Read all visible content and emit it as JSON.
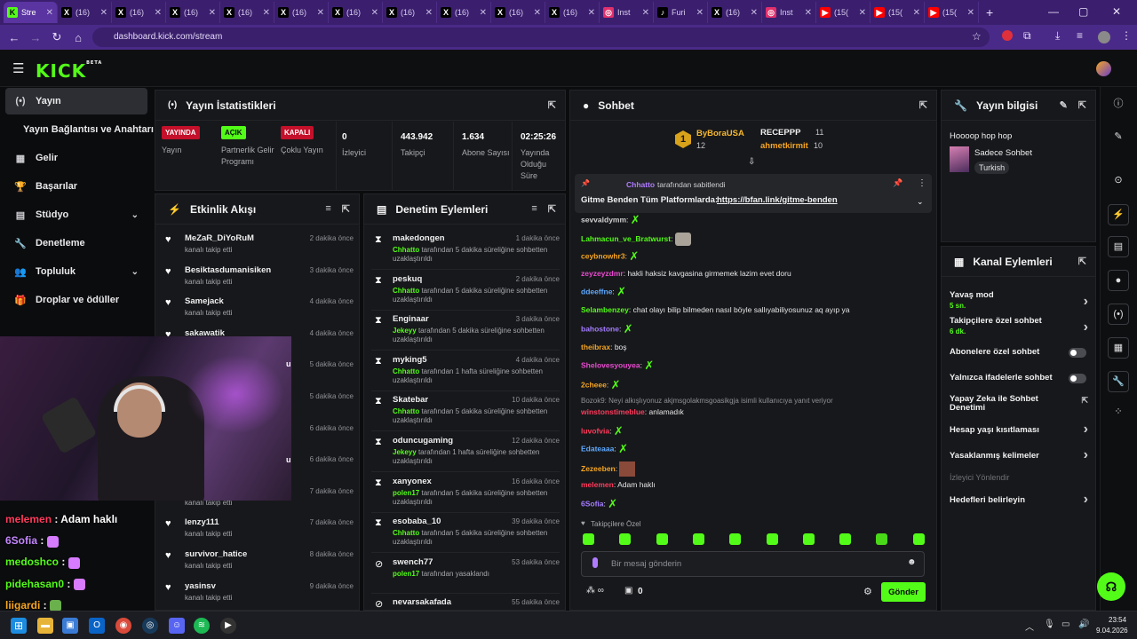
{
  "browser": {
    "tabs": [
      {
        "label": "Stre",
        "icon": "kick-icon",
        "active": true
      },
      {
        "label": "(16)",
        "icon": "x-icon"
      },
      {
        "label": "(16)",
        "icon": "x-icon"
      },
      {
        "label": "(16)",
        "icon": "x-icon"
      },
      {
        "label": "(16)",
        "icon": "x-icon"
      },
      {
        "label": "(16)",
        "icon": "x-icon"
      },
      {
        "label": "(16)",
        "icon": "x-icon"
      },
      {
        "label": "(16)",
        "icon": "x-icon"
      },
      {
        "label": "(16)",
        "icon": "x-icon"
      },
      {
        "label": "(16)",
        "icon": "x-icon"
      },
      {
        "label": "(16)",
        "icon": "x-icon"
      },
      {
        "label": "Inst",
        "icon": "instagram-icon"
      },
      {
        "label": "Furi",
        "icon": "tiktok-icon"
      },
      {
        "label": "(16)",
        "icon": "x-icon"
      },
      {
        "label": "Inst",
        "icon": "instagram-icon"
      },
      {
        "label": "(15(",
        "icon": "youtube-icon"
      },
      {
        "label": "(15(",
        "icon": "youtube-icon"
      },
      {
        "label": "(15(",
        "icon": "youtube-icon"
      }
    ],
    "url": "dashboard.kick.com/stream"
  },
  "brand": {
    "logo": "KICK",
    "beta": "BETA",
    "accent": "#53fc18"
  },
  "sidebar": {
    "items": [
      {
        "label": "Yayın",
        "icon": "broadcast-icon",
        "active": true
      },
      {
        "label": "Yayın Bağlantısı ve Anahtarı",
        "icon": ""
      },
      {
        "label": "Gelir",
        "icon": "bank-icon"
      },
      {
        "label": "Başarılar",
        "icon": "trophy-icon"
      },
      {
        "label": "Stüdyo",
        "icon": "studio-icon",
        "chevron": true
      },
      {
        "label": "Denetleme",
        "icon": "wrench-icon"
      },
      {
        "label": "Topluluk",
        "icon": "community-icon",
        "chevron": true
      },
      {
        "label": "Droplar ve ödüller",
        "icon": "gift-icon"
      }
    ]
  },
  "stats": {
    "title": "Yayın İstatistikleri",
    "live_badge": "YAYINDA",
    "live_label": "Yayın",
    "partner_badge": "AÇIK",
    "partner_label": "Partnerlik Gelir Programı",
    "multi_badge": "KAPALI",
    "multi_label": "Çoklu Yayın",
    "viewers_value": "0",
    "viewers_label": "İzleyici",
    "followers_value": "443.942",
    "followers_label": "Takipçi",
    "subs_value": "1.634",
    "subs_label": "Abone Sayısı",
    "uptime_value": "02:25:26",
    "uptime_label": "Yayında Olduğu Süre"
  },
  "events": {
    "title": "Etkinlik Akışı",
    "rows": [
      {
        "name": "MeZaR_DiYoRuM",
        "sub": "kanalı takip etti",
        "time": "2 dakika önce"
      },
      {
        "name": "Besiktasdumanisiken",
        "sub": "kanalı takip etti",
        "time": "3 dakika önce"
      },
      {
        "name": "Samejack",
        "sub": "kanalı takip etti",
        "time": "4 dakika önce"
      },
      {
        "name": "sakawatik",
        "sub": "",
        "time": "4 dakika önce"
      },
      {
        "name": "",
        "sub": "",
        "time": "5 dakika önce"
      },
      {
        "name": "",
        "sub": "",
        "time": "5 dakika önce"
      },
      {
        "name": "",
        "sub": "",
        "time": "6 dakika önce"
      },
      {
        "name": "",
        "sub": "",
        "time": "6 dakika önce"
      },
      {
        "name": "",
        "sub": "kanalı takip etti",
        "time": "7 dakika önce"
      },
      {
        "name": "lenzy111",
        "sub": "kanalı takip etti",
        "time": "7 dakika önce"
      },
      {
        "name": "survivor_hatice",
        "sub": "kanalı takip etti",
        "time": "8 dakika önce"
      },
      {
        "name": "yasinsv",
        "sub": "kanalı takip etti",
        "time": "9 dakika önce"
      }
    ]
  },
  "moderation": {
    "title": "Denetim Eylemleri",
    "rows": [
      {
        "name": "makedongen",
        "by": "Chhatto",
        "action": "tarafından 5 dakika süreliğine sohbetten uzaklaştırıldı",
        "time": "1 dakika önce",
        "icon": "hourglass-icon"
      },
      {
        "name": "peskuq",
        "by": "Chhatto",
        "action": "tarafından 5 dakika süreliğine sohbetten uzaklaştırıldı",
        "time": "2 dakika önce",
        "icon": "hourglass-icon"
      },
      {
        "name": "Enginaar",
        "by": "Jekeyy",
        "action": "tarafından 5 dakika süreliğine sohbetten uzaklaştırıldı",
        "time": "3 dakika önce",
        "icon": "hourglass-icon"
      },
      {
        "name": "myking5",
        "by": "Chhatto",
        "action": "tarafından 1 hafta süreliğine sohbetten uzaklaştırıldı",
        "time": "4 dakika önce",
        "icon": "hourglass-icon"
      },
      {
        "name": "Skatebar",
        "by": "Chhatto",
        "action": "tarafından 5 dakika süreliğine sohbetten uzaklaştırıldı",
        "time": "10 dakika önce",
        "icon": "hourglass-icon"
      },
      {
        "name": "oduncugaming",
        "by": "Jekeyy",
        "action": "tarafından 1 hafta süreliğine sohbetten uzaklaştırıldı",
        "time": "12 dakika önce",
        "icon": "hourglass-icon"
      },
      {
        "name": "xanyonex",
        "by": "polen17",
        "action": "tarafından 5 dakika süreliğine sohbetten uzaklaştırıldı",
        "time": "16 dakika önce",
        "icon": "hourglass-icon"
      },
      {
        "name": "esobaba_10",
        "by": "Chhatto",
        "action": "tarafından 5 dakika süreliğine sohbetten uzaklaştırıldı",
        "time": "39 dakika önce",
        "icon": "hourglass-icon"
      },
      {
        "name": "swench77",
        "by": "polen17",
        "action": "tarafından yasaklandı",
        "time": "53 dakika önce",
        "icon": "ban-icon"
      },
      {
        "name": "nevarsakafada",
        "by": "",
        "action": "",
        "time": "55 dakika önce",
        "icon": "ban-icon"
      }
    ]
  },
  "chat": {
    "title": "Sohbet",
    "leaderboard": [
      {
        "name": "ByBoraUSA",
        "count": "12"
      },
      {
        "name": "RECEPPP",
        "count": "11"
      },
      {
        "name": "ahmetkirmit",
        "count": "10"
      }
    ],
    "pinned_by": "Chhatto",
    "pinned_suffix": "tarafından sabitlendi",
    "pinned_text": "Gitme Benden Tüm Platformlarda:",
    "pinned_link": "https://bfan.link/gitme-benden",
    "messages": [
      {
        "user": "sevvaldymm",
        "text": "",
        "color": "#d0d0d2",
        "emote": true
      },
      {
        "user": "Lahmacun_ve_Bratwurst",
        "text": "",
        "color": "#53fc18",
        "emote": "cat"
      },
      {
        "user": "ceybnowhr3",
        "text": "",
        "color": "#f5a623",
        "emote": true
      },
      {
        "user": "zeyzeyzdmr",
        "text": "hakli haksiz kavgasina girmemek lazim evet doru",
        "color": "#e94bd1",
        "emote": false
      },
      {
        "user": "ddeeffne",
        "text": "",
        "color": "#5ea9ff",
        "emote": true
      },
      {
        "user": "Selambenzey",
        "text": "chat olayı bilip bilmeden nasıl böyle sallıyabiliyosunuz aq ayıp ya",
        "color": "#53fc18",
        "emote": false
      },
      {
        "user": "bahostone",
        "text": "",
        "color": "#a47cff",
        "emote": true
      },
      {
        "user": "theibrax",
        "text": "boş",
        "color": "#f5a623",
        "emote": false
      },
      {
        "user": "Shelovesyouyea",
        "text": "",
        "color": "#e94bd1",
        "emote": true
      },
      {
        "user": "2cheee",
        "text": "",
        "color": "#f5a623",
        "emote": true
      },
      {
        "user": "winstonstimeblue",
        "text": "anlamadık",
        "color": "#ff3b5c",
        "emote": false
      },
      {
        "user": "luvofvia",
        "text": "",
        "color": "#ff3b5c",
        "emote": true
      },
      {
        "user": "Edateaaa",
        "text": "",
        "color": "#5ea9ff",
        "emote": true
      },
      {
        "user": "Zezeeben",
        "text": "",
        "color": "#f5a623",
        "emote": "pic"
      },
      {
        "user": "melemen",
        "text": "Adam haklı",
        "color": "#ff3b5c",
        "emote": false
      },
      {
        "user": "6Sofia",
        "text": "",
        "color": "#a47cff",
        "emote": true
      }
    ],
    "reply_hint": "Bozok9: Neyi alkışlıyonuz akjmsgolakmsgoasikgja isimli kullanıcıya yanıt veriyor",
    "follower_only": "Takipçilere Özel",
    "input_placeholder": "Bir mesaj gönderin",
    "points": "0",
    "send_label": "Gönder"
  },
  "stream_info": {
    "title": "Yayın bilgisi",
    "stream_title": "Hoooop hop hop",
    "category": "Sadece Sohbet",
    "language": "Turkish"
  },
  "channel_actions": {
    "title": "Kanal Eylemleri",
    "rows": [
      {
        "label": "Yavaş mod",
        "sub": "5 sn.",
        "kind": "chevron"
      },
      {
        "label": "Takipçilere özel sohbet",
        "sub": "6 dk.",
        "kind": "chevron"
      },
      {
        "label": "Abonelere özel sohbet",
        "sub": "",
        "kind": "toggle"
      },
      {
        "label": "Yalnızca ifadelerle sohbet",
        "sub": "",
        "kind": "toggle"
      },
      {
        "label": "Yapay Zeka ile Sohbet Denetimi",
        "sub": "",
        "kind": "external"
      },
      {
        "label": "Hesap yaşı kısıtlaması",
        "sub": "",
        "kind": "chevron"
      },
      {
        "label": "Yasaklanmış kelimeler",
        "sub": "",
        "kind": "chevron"
      },
      {
        "label": "Hedefleri belirleyin",
        "sub": "",
        "kind": "chevron"
      }
    ],
    "section_label": "İzleyici Yönlendir"
  },
  "overlay_chat": [
    {
      "user": "melemen",
      "text": "Adam haklı",
      "color": "#ff3b5c"
    },
    {
      "user": "6Sofia",
      "text": "",
      "color": "#c486ff"
    },
    {
      "user": "medoshco",
      "text": "",
      "color": "#53fc18"
    },
    {
      "user": "pidehasan0",
      "text": "",
      "color": "#53fc18"
    },
    {
      "user": "liigardi",
      "text": "",
      "color": "#f5a623"
    }
  ],
  "webcam_fragments": [
    "u!",
    "u!"
  ],
  "taskbar": {
    "time": "23:54",
    "date": "9.04.2026"
  }
}
